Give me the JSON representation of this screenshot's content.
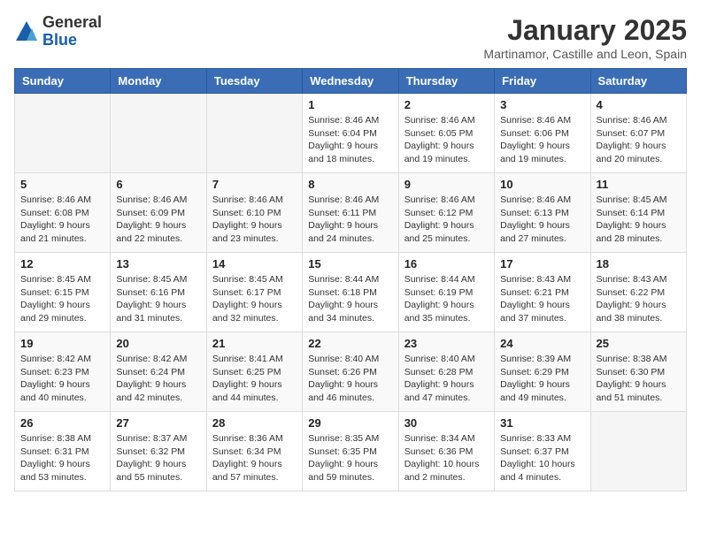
{
  "logo": {
    "general": "General",
    "blue": "Blue"
  },
  "header": {
    "month": "January 2025",
    "location": "Martinamor, Castille and Leon, Spain"
  },
  "weekdays": [
    "Sunday",
    "Monday",
    "Tuesday",
    "Wednesday",
    "Thursday",
    "Friday",
    "Saturday"
  ],
  "weeks": [
    [
      null,
      null,
      null,
      {
        "day": "1",
        "sunrise": "8:46 AM",
        "sunset": "6:04 PM",
        "daylight": "9 hours and 18 minutes."
      },
      {
        "day": "2",
        "sunrise": "8:46 AM",
        "sunset": "6:05 PM",
        "daylight": "9 hours and 19 minutes."
      },
      {
        "day": "3",
        "sunrise": "8:46 AM",
        "sunset": "6:06 PM",
        "daylight": "9 hours and 19 minutes."
      },
      {
        "day": "4",
        "sunrise": "8:46 AM",
        "sunset": "6:07 PM",
        "daylight": "9 hours and 20 minutes."
      }
    ],
    [
      {
        "day": "5",
        "sunrise": "8:46 AM",
        "sunset": "6:08 PM",
        "daylight": "9 hours and 21 minutes."
      },
      {
        "day": "6",
        "sunrise": "8:46 AM",
        "sunset": "6:09 PM",
        "daylight": "9 hours and 22 minutes."
      },
      {
        "day": "7",
        "sunrise": "8:46 AM",
        "sunset": "6:10 PM",
        "daylight": "9 hours and 23 minutes."
      },
      {
        "day": "8",
        "sunrise": "8:46 AM",
        "sunset": "6:11 PM",
        "daylight": "9 hours and 24 minutes."
      },
      {
        "day": "9",
        "sunrise": "8:46 AM",
        "sunset": "6:12 PM",
        "daylight": "9 hours and 25 minutes."
      },
      {
        "day": "10",
        "sunrise": "8:46 AM",
        "sunset": "6:13 PM",
        "daylight": "9 hours and 27 minutes."
      },
      {
        "day": "11",
        "sunrise": "8:45 AM",
        "sunset": "6:14 PM",
        "daylight": "9 hours and 28 minutes."
      }
    ],
    [
      {
        "day": "12",
        "sunrise": "8:45 AM",
        "sunset": "6:15 PM",
        "daylight": "9 hours and 29 minutes."
      },
      {
        "day": "13",
        "sunrise": "8:45 AM",
        "sunset": "6:16 PM",
        "daylight": "9 hours and 31 minutes."
      },
      {
        "day": "14",
        "sunrise": "8:45 AM",
        "sunset": "6:17 PM",
        "daylight": "9 hours and 32 minutes."
      },
      {
        "day": "15",
        "sunrise": "8:44 AM",
        "sunset": "6:18 PM",
        "daylight": "9 hours and 34 minutes."
      },
      {
        "day": "16",
        "sunrise": "8:44 AM",
        "sunset": "6:19 PM",
        "daylight": "9 hours and 35 minutes."
      },
      {
        "day": "17",
        "sunrise": "8:43 AM",
        "sunset": "6:21 PM",
        "daylight": "9 hours and 37 minutes."
      },
      {
        "day": "18",
        "sunrise": "8:43 AM",
        "sunset": "6:22 PM",
        "daylight": "9 hours and 38 minutes."
      }
    ],
    [
      {
        "day": "19",
        "sunrise": "8:42 AM",
        "sunset": "6:23 PM",
        "daylight": "9 hours and 40 minutes."
      },
      {
        "day": "20",
        "sunrise": "8:42 AM",
        "sunset": "6:24 PM",
        "daylight": "9 hours and 42 minutes."
      },
      {
        "day": "21",
        "sunrise": "8:41 AM",
        "sunset": "6:25 PM",
        "daylight": "9 hours and 44 minutes."
      },
      {
        "day": "22",
        "sunrise": "8:40 AM",
        "sunset": "6:26 PM",
        "daylight": "9 hours and 46 minutes."
      },
      {
        "day": "23",
        "sunrise": "8:40 AM",
        "sunset": "6:28 PM",
        "daylight": "9 hours and 47 minutes."
      },
      {
        "day": "24",
        "sunrise": "8:39 AM",
        "sunset": "6:29 PM",
        "daylight": "9 hours and 49 minutes."
      },
      {
        "day": "25",
        "sunrise": "8:38 AM",
        "sunset": "6:30 PM",
        "daylight": "9 hours and 51 minutes."
      }
    ],
    [
      {
        "day": "26",
        "sunrise": "8:38 AM",
        "sunset": "6:31 PM",
        "daylight": "9 hours and 53 minutes."
      },
      {
        "day": "27",
        "sunrise": "8:37 AM",
        "sunset": "6:32 PM",
        "daylight": "9 hours and 55 minutes."
      },
      {
        "day": "28",
        "sunrise": "8:36 AM",
        "sunset": "6:34 PM",
        "daylight": "9 hours and 57 minutes."
      },
      {
        "day": "29",
        "sunrise": "8:35 AM",
        "sunset": "6:35 PM",
        "daylight": "9 hours and 59 minutes."
      },
      {
        "day": "30",
        "sunrise": "8:34 AM",
        "sunset": "6:36 PM",
        "daylight": "10 hours and 2 minutes."
      },
      {
        "day": "31",
        "sunrise": "8:33 AM",
        "sunset": "6:37 PM",
        "daylight": "10 hours and 4 minutes."
      },
      null
    ]
  ]
}
